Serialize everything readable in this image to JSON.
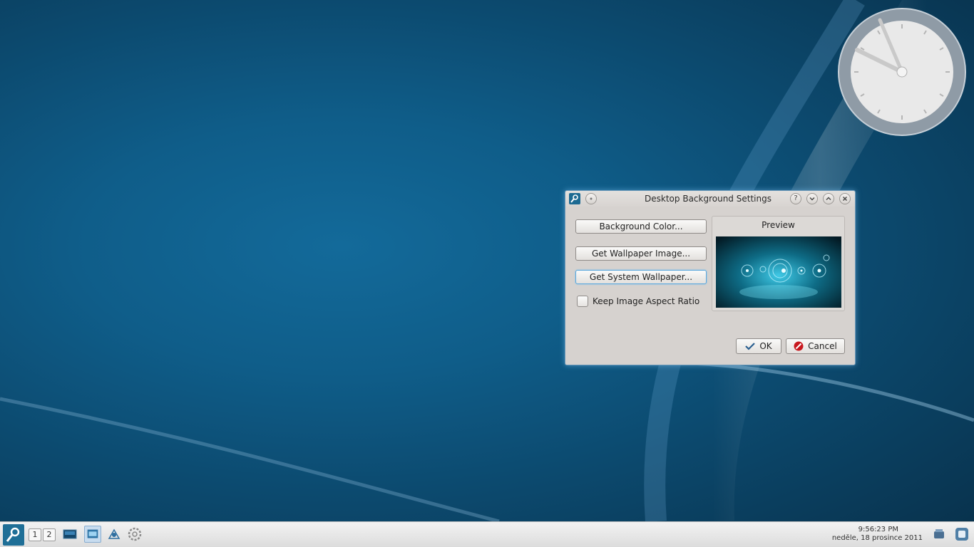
{
  "dialog": {
    "title": "Desktop Background Settings",
    "buttons": {
      "background_color": "Background Color...",
      "get_wallpaper_image": "Get Wallpaper Image...",
      "get_system_wallpaper": "Get System Wallpaper..."
    },
    "keep_aspect_label": "Keep Image Aspect Ratio",
    "keep_aspect_checked": false,
    "preview_label": "Preview",
    "ok_label": "OK",
    "cancel_label": "Cancel",
    "titlebar_buttons": [
      "help-icon",
      "minimize-icon",
      "maximize-icon",
      "close-icon"
    ]
  },
  "taskbar": {
    "desktops": [
      "1",
      "2"
    ],
    "clock_time": "9:56:23 PM",
    "clock_date": "neděle, 18 prosince 2011"
  },
  "colors": {
    "accent": "#1f6f97",
    "wallpaper": "#0f5d89",
    "dialog_bg": "#d6d2cf"
  }
}
